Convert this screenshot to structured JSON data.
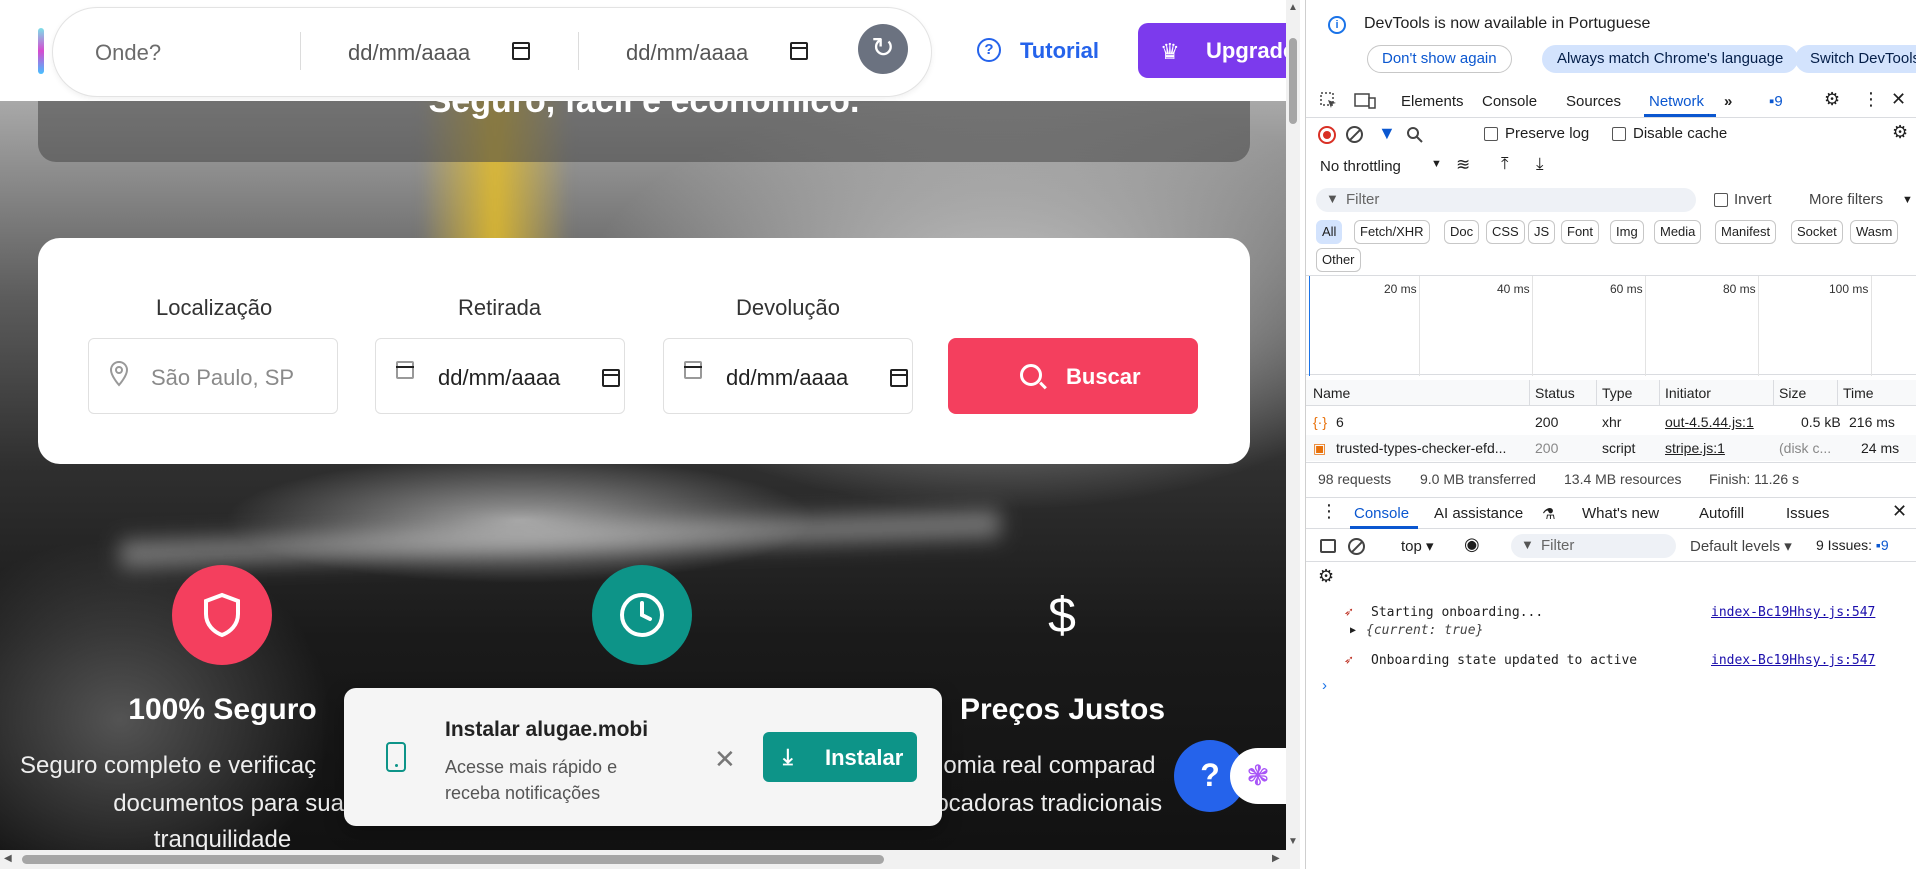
{
  "page": {
    "hero_text": "Seguro, fácil e econômico.",
    "nav": {
      "where_placeholder": "Onde?",
      "date1": "dd/mm/aaaa",
      "date2": "dd/mm/aaaa",
      "tutorial": "Tutorial",
      "upgrade": "Upgrade"
    },
    "search": {
      "location_label": "Localização",
      "location_placeholder": "São Paulo, SP",
      "pickup_label": "Retirada",
      "pickup_value": "dd/mm/aaaa",
      "return_label": "Devolução",
      "return_value": "dd/mm/aaaa",
      "button": "Buscar"
    },
    "features": [
      {
        "title": "100% Seguro",
        "desc1": "Seguro completo e verificaç",
        "desc2": "documentos para sua",
        "desc3": "tranquilidade",
        "color": "#f43f5e",
        "icon": "shield-icon"
      },
      {
        "title": "",
        "color": "#0d9488",
        "icon": "clock-icon"
      },
      {
        "title": "Preços Justos",
        "desc1": "nomia real comparad",
        "desc2": "locadoras tradicionais",
        "icon": "dollar-icon"
      }
    ],
    "install_toast": {
      "title": "Instalar alugae.mobi",
      "desc": "Acesse mais rápido e receba notificações",
      "button": "Instalar"
    }
  },
  "devtools": {
    "info": "DevTools is now available in Portuguese",
    "btn_dont_show": "Don't show again",
    "btn_match": "Always match Chrome's language",
    "btn_switch": "Switch DevTools",
    "tabs": [
      "Elements",
      "Console",
      "Sources",
      "Network"
    ],
    "active_tab": "Network",
    "issues_badge": "9",
    "preserve_log": "Preserve log",
    "disable_cache": "Disable cache",
    "throttling": "No throttling",
    "filter_placeholder": "Filter",
    "invert": "Invert",
    "more_filters": "More filters",
    "type_chips": [
      "All",
      "Fetch/XHR",
      "Doc",
      "CSS",
      "JS",
      "Font",
      "Img",
      "Media",
      "Manifest",
      "Socket",
      "Wasm",
      "Other"
    ],
    "timeline_labels": [
      "20 ms",
      "40 ms",
      "60 ms",
      "80 ms",
      "100 ms"
    ],
    "columns": [
      "Name",
      "Status",
      "Type",
      "Initiator",
      "Size",
      "Time"
    ],
    "rows": [
      {
        "name": "6",
        "status": "200",
        "type": "xhr",
        "initiator": "out-4.5.44.js:1",
        "size": "0.5 kB",
        "time": "216 ms"
      },
      {
        "name": "trusted-types-checker-efd...",
        "status": "200",
        "type": "script",
        "initiator": "stripe.js:1",
        "size": "(disk c...",
        "time": "24 ms"
      }
    ],
    "summary": {
      "requests": "98 requests",
      "transferred": "9.0 MB transferred",
      "resources": "13.4 MB resources",
      "finish": "Finish: 11.26 s"
    },
    "drawer_tabs": [
      "Console",
      "AI assistance",
      "What's new",
      "Autofill",
      "Issues"
    ],
    "console_context": "top",
    "console_filter": "Filter",
    "levels": "Default levels",
    "issues_count": "9 Issues:",
    "issues_num": "9",
    "logs": [
      {
        "text": "Starting onboarding...",
        "src": "index-Bc19Hhsy.js:547",
        "sub": "{current: true}"
      },
      {
        "text": "Onboarding state updated to active",
        "src": "index-Bc19Hhsy.js:547"
      }
    ]
  }
}
